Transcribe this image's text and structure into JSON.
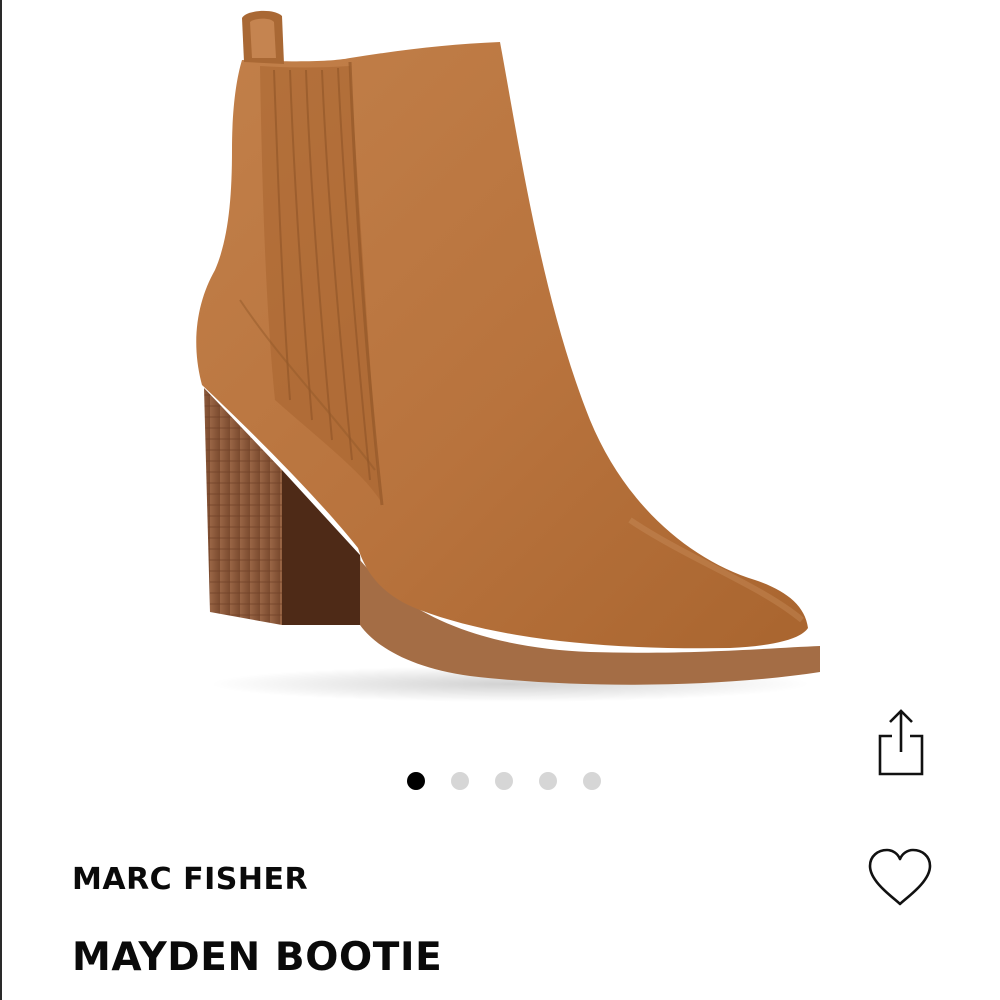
{
  "product": {
    "brand": "MARC FISHER",
    "name": "MAYDEN BOOTIE",
    "image_description_icon": "suede-ankle-bootie-image"
  },
  "carousel": {
    "total": 5,
    "active_index": 0
  },
  "actions": {
    "share_icon": "share-icon",
    "favorite_icon": "heart-outline-icon"
  },
  "colors": {
    "suede": "#b9753f",
    "suede_dark": "#9e5f2f",
    "heel_wood": "#8a5a3c",
    "sole": "#a46d45",
    "dot_active": "#000000",
    "dot_inactive": "#d6d6d6"
  }
}
